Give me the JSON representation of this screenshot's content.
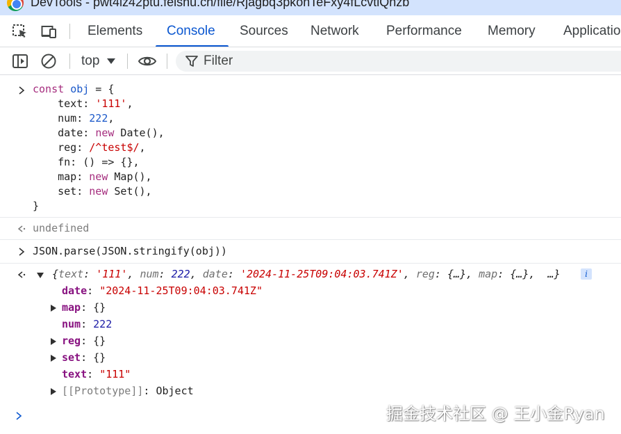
{
  "window": {
    "title": "DevTools - pwt4lz42ptu.feishu.cn/file/Rjagbq3pkonTeFxy4fLcvtiQnzb"
  },
  "tabs": [
    "Elements",
    "Console",
    "Sources",
    "Network",
    "Performance",
    "Memory",
    "Applicatio"
  ],
  "active_tab": "Console",
  "toolbar": {
    "context": "top",
    "filter_placeholder": "Filter"
  },
  "console": {
    "input1": {
      "lines": [
        [
          {
            "t": "const ",
            "c": "kw"
          },
          {
            "t": "obj",
            "c": "var"
          },
          {
            "t": " = {",
            "c": "plain"
          }
        ],
        [
          {
            "t": "    text: ",
            "c": "plain"
          },
          {
            "t": "'111'",
            "c": "str"
          },
          {
            "t": ",",
            "c": "plain"
          }
        ],
        [
          {
            "t": "    num: ",
            "c": "plain"
          },
          {
            "t": "222",
            "c": "var"
          },
          {
            "t": ",",
            "c": "plain"
          }
        ],
        [
          {
            "t": "    date: ",
            "c": "plain"
          },
          {
            "t": "new",
            "c": "kw"
          },
          {
            "t": " Date(),",
            "c": "plain"
          }
        ],
        [
          {
            "t": "    reg: ",
            "c": "plain"
          },
          {
            "t": "/^test$/",
            "c": "str"
          },
          {
            "t": ",",
            "c": "plain"
          }
        ],
        [
          {
            "t": "    fn: () => {},",
            "c": "plain"
          }
        ],
        [
          {
            "t": "    map: ",
            "c": "plain"
          },
          {
            "t": "new",
            "c": "kw"
          },
          {
            "t": " Map(),",
            "c": "plain"
          }
        ],
        [
          {
            "t": "    set: ",
            "c": "plain"
          },
          {
            "t": "new",
            "c": "kw"
          },
          {
            "t": " Set(),",
            "c": "plain"
          }
        ],
        [
          {
            "t": "}",
            "c": "plain"
          }
        ]
      ]
    },
    "result1": "undefined",
    "input2": "JSON.parse(JSON.stringify(obj))",
    "result2": {
      "preview": [
        {
          "t": "{",
          "c": "plain"
        },
        {
          "t": "text",
          "c": "preview-key"
        },
        {
          "t": ": ",
          "c": "plain"
        },
        {
          "t": "'111'",
          "c": "str"
        },
        {
          "t": ", ",
          "c": "plain"
        },
        {
          "t": "num",
          "c": "preview-key"
        },
        {
          "t": ": ",
          "c": "plain"
        },
        {
          "t": "222",
          "c": "num"
        },
        {
          "t": ", ",
          "c": "plain"
        },
        {
          "t": "date",
          "c": "preview-key"
        },
        {
          "t": ": ",
          "c": "plain"
        },
        {
          "t": "'2024-11-25T09:04:03.741Z'",
          "c": "str"
        },
        {
          "t": ", ",
          "c": "plain"
        },
        {
          "t": "reg",
          "c": "preview-key"
        },
        {
          "t": ": {…}, ",
          "c": "plain"
        },
        {
          "t": "map",
          "c": "preview-key"
        },
        {
          "t": ": {…},  …}",
          "c": "plain"
        }
      ],
      "info_badge": "i",
      "properties": [
        {
          "key": "date",
          "value": "\"2024-11-25T09:04:03.741Z\"",
          "vtype": "str",
          "expandable": false
        },
        {
          "key": "map",
          "value": "{}",
          "vtype": "plain",
          "expandable": true
        },
        {
          "key": "num",
          "value": "222",
          "vtype": "num",
          "expandable": false
        },
        {
          "key": "reg",
          "value": "{}",
          "vtype": "plain",
          "expandable": true
        },
        {
          "key": "set",
          "value": "{}",
          "vtype": "plain",
          "expandable": true
        },
        {
          "key": "text",
          "value": "\"111\"",
          "vtype": "str",
          "expandable": false
        },
        {
          "key": "[[Prototype]]",
          "value": "Object",
          "vtype": "plain",
          "expandable": true,
          "internal": true
        }
      ]
    }
  },
  "watermark": "掘金技术社区 @ 王小金Ryan",
  "colors": {
    "accent": "#0b57d0",
    "titlebar": "#d3e3fd",
    "keyword": "#a52d7e",
    "string": "#c80000",
    "number": "#1a1aa6",
    "property": "#881280"
  }
}
